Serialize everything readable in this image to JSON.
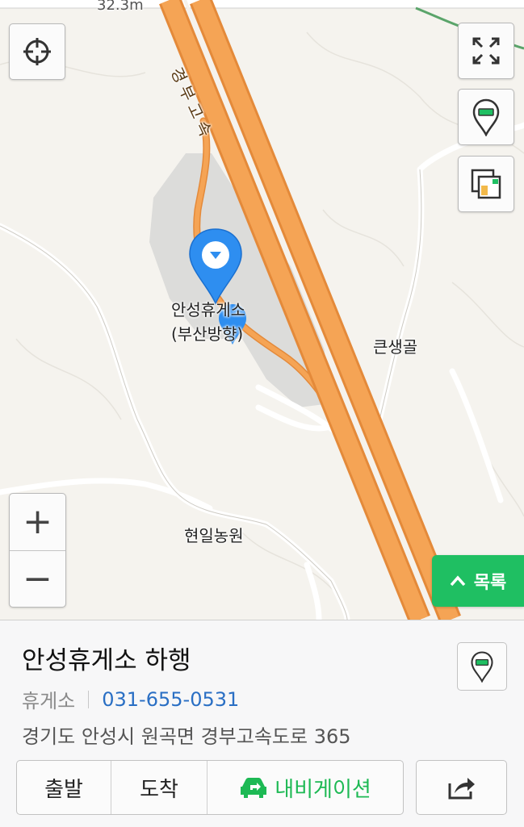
{
  "map": {
    "labels": {
      "top_partial": "32.3m",
      "highway": "경부고속",
      "poi_line1": "안성휴게소",
      "poi_line2": "(부산방향)",
      "village1": "큰생골",
      "village2": "현일농원"
    },
    "controls": {
      "locate_icon": "crosshair-icon",
      "fullscreen_icon": "expand-icon",
      "marker_toggle_icon": "map-pin-icon",
      "layers_icon": "layers-icon",
      "zoom_in": "+",
      "zoom_out": "−"
    },
    "list_button": {
      "label": "목록",
      "icon": "chevron-up-icon"
    }
  },
  "place": {
    "name": "안성휴게소 하행",
    "category": "휴게소",
    "phone": "031-655-0531",
    "address": "경기도 안성시 원곡면 경부고속도로 365"
  },
  "actions": {
    "depart": "출발",
    "arrive": "도착",
    "navigation": "내비게이션",
    "share_icon": "share-icon"
  },
  "colors": {
    "highway": "#f5a455",
    "highway_edge": "#e48a3a",
    "accent_green": "#1fbf62",
    "link_blue": "#2a6fc4",
    "marker_blue": "#2e8ef0"
  }
}
